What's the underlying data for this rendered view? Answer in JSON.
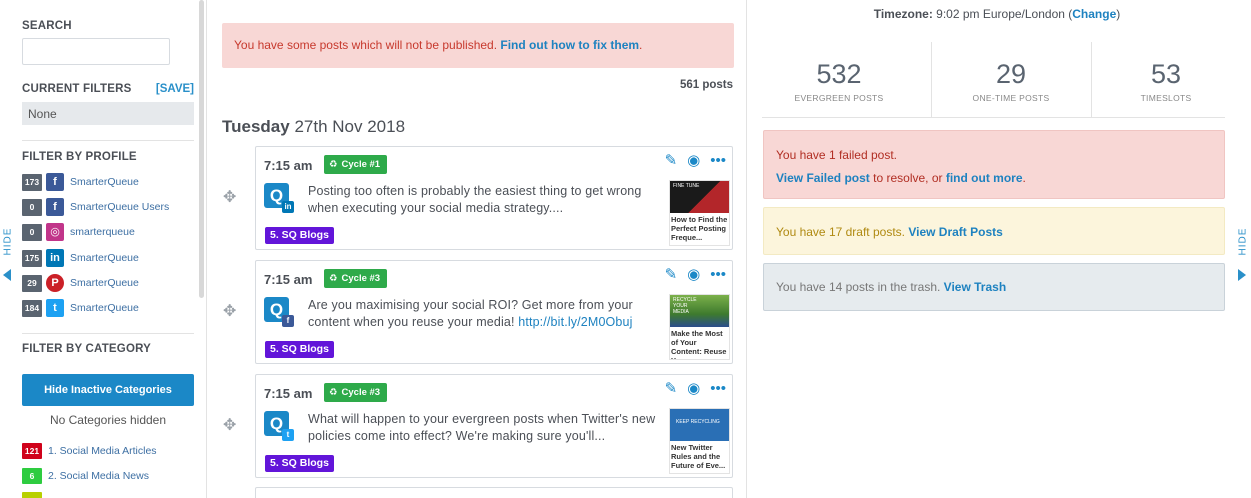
{
  "sidebar": {
    "search_label": "SEARCH",
    "search_placeholder": "",
    "current_filters_label": "CURRENT FILTERS",
    "save_label": "[SAVE]",
    "current_filters_value": "None",
    "filter_profile_label": "FILTER BY PROFILE",
    "profiles": [
      {
        "count": "173",
        "network": "facebook",
        "label": "SmarterQueue",
        "color": "#3b5998"
      },
      {
        "count": "0",
        "network": "facebook-group",
        "label": "SmarterQueue Users",
        "color": "#3b5998"
      },
      {
        "count": "0",
        "network": "instagram",
        "label": "smarterqueue",
        "color": "#c1358a"
      },
      {
        "count": "175",
        "network": "linkedin",
        "label": "SmarterQueue",
        "color": "#0077b5"
      },
      {
        "count": "29",
        "network": "pinterest",
        "label": "SmarterQueue",
        "color": "#cb2027"
      },
      {
        "count": "184",
        "network": "twitter",
        "label": "SmarterQueue",
        "color": "#1da1f2"
      }
    ],
    "filter_category_label": "FILTER BY CATEGORY",
    "hide_inactive_label": "Hide Inactive Categories",
    "no_categories_hidden": "No Categories hidden",
    "categories": [
      {
        "count": "121",
        "label": "1. Social Media Articles",
        "color": "#d0021b"
      },
      {
        "count": "6",
        "label": "2. Social Media News",
        "color": "#2ecc40"
      },
      {
        "count": "",
        "label": "",
        "color": "#b8d000"
      }
    ],
    "hide_label": "HIDE"
  },
  "main": {
    "warning_text": "You have some posts which will not be published. ",
    "warning_link": "Find out how to fix them",
    "warning_suffix": ".",
    "post_count": "561 posts",
    "day_bold": "Tuesday",
    "day_rest": " 27th Nov 2018",
    "posts": [
      {
        "time": "7:15 am",
        "cycle": "Cycle #1",
        "network": "linkedin",
        "network_color": "#0077b5",
        "text": "Posting too often is probably the easiest thing to get wrong when executing your social media strategy....",
        "link": "",
        "tag": "5. SQ Blogs",
        "thumb_title": "How to Find the Perfect Posting Freque...",
        "thumb_caption": "FINE TUNE",
        "thumb_color": "#1a1a1a"
      },
      {
        "time": "7:15 am",
        "cycle": "Cycle #3",
        "network": "facebook",
        "network_color": "#3b5998",
        "text": "Are you maximising your social ROI? Get more from your content when you reuse your media! ",
        "link": "http://bit.ly/2M0Obuj",
        "tag": "5. SQ Blogs",
        "thumb_title": "Make the Most of Your Content: Reuse Y...",
        "thumb_caption": "RECYCLE YOUR MEDIA",
        "thumb_color": "#5c8a3a"
      },
      {
        "time": "7:15 am",
        "cycle": "Cycle #3",
        "network": "twitter",
        "network_color": "#1da1f2",
        "text": "What will happen to your evergreen posts when Twitter's new policies come into effect? We're making sure you'll...",
        "link": "",
        "tag": "5. SQ Blogs",
        "thumb_title": "New Twitter Rules and the Future of Eve...",
        "thumb_caption": "KEEP RECYCLING",
        "thumb_color": "#2a6fb5"
      }
    ]
  },
  "right": {
    "timezone_label": "Timezone:",
    "timezone_value": " 9:02 pm Europe/London (",
    "timezone_change": "Change",
    "timezone_close": ")",
    "stats": [
      {
        "num": "532",
        "label": "EVERGREEN POSTS"
      },
      {
        "num": "29",
        "label": "ONE-TIME POSTS"
      },
      {
        "num": "53",
        "label": "TIMESLOTS"
      }
    ],
    "failed_line1": "You have 1 failed post.",
    "failed_link1": "View Failed post",
    "failed_mid": " to resolve, or ",
    "failed_link2": "find out more",
    "failed_end": ".",
    "draft_text": "You have 17 draft posts. ",
    "draft_link": "View Draft Posts",
    "trash_text": "You have 14 posts in the trash. ",
    "trash_link": "View Trash",
    "hide_label": "HIDE"
  },
  "colors": {
    "accent": "#1b88c7",
    "cycle_green": "#2eaa4a",
    "tag_purple": "#6215d9"
  }
}
